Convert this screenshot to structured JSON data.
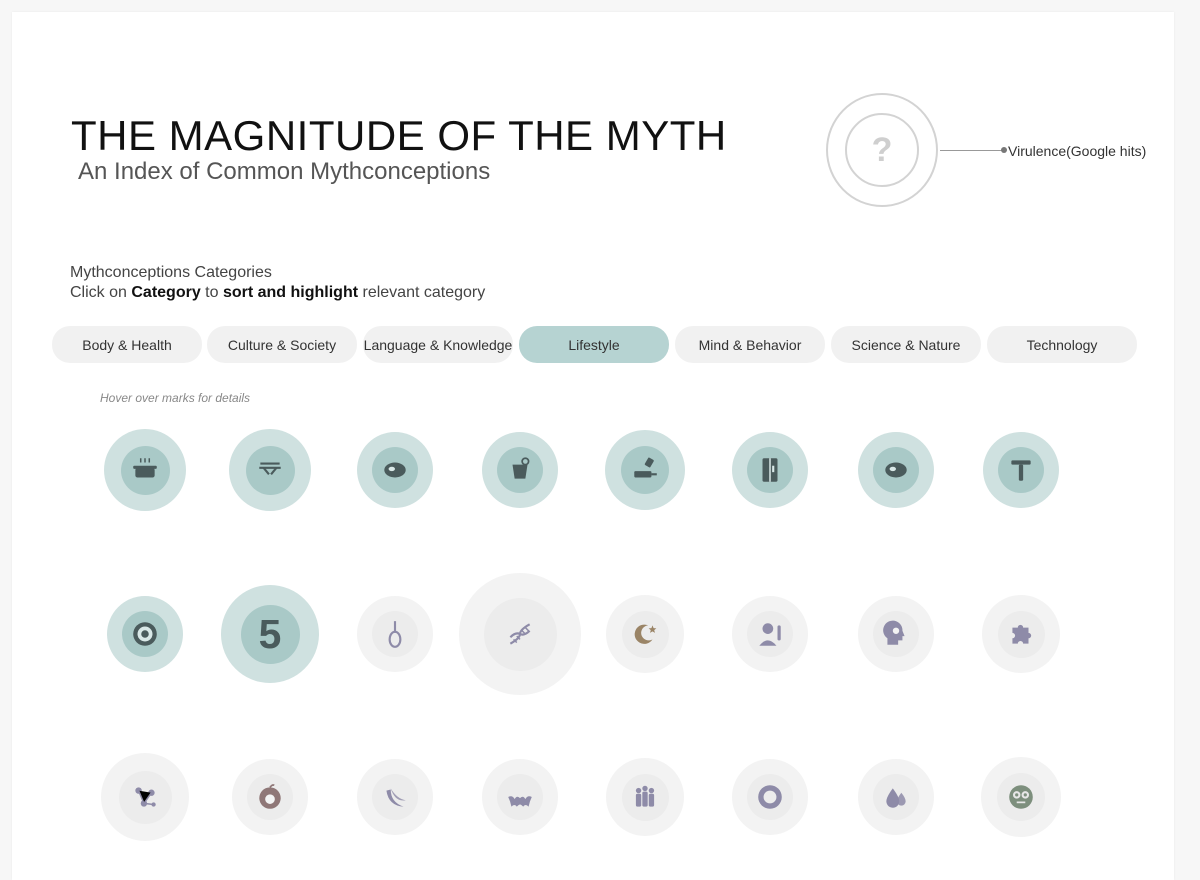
{
  "header": {
    "title": "THE MAGNITUDE OF THE MYTH",
    "subtitle": "An Index of Common Mythconceptions"
  },
  "legend": {
    "symbol": "?",
    "label": "Virulence(Google hits)"
  },
  "instructions": {
    "line1": "Mythconceptions Categories",
    "line2_parts": [
      "Click on ",
      "Category",
      " to ",
      "sort and highlight",
      " relevant category"
    ]
  },
  "tabs": [
    {
      "label": "Body & Health",
      "active": false
    },
    {
      "label": "Culture & Society",
      "active": false
    },
    {
      "label": "Language & Knowledge",
      "active": false
    },
    {
      "label": "Lifestyle",
      "active": true
    },
    {
      "label": "Mind & Behavior",
      "active": false
    },
    {
      "label": "Science & Nature",
      "active": false
    },
    {
      "label": "Technology",
      "active": false
    }
  ],
  "hint": "Hover over marks for details",
  "marks": [
    {
      "icon": "pot-icon",
      "highlighted": true
    },
    {
      "icon": "chopsticks-icon",
      "highlighted": true
    },
    {
      "icon": "steak-icon",
      "highlighted": true
    },
    {
      "icon": "cup-icon",
      "highlighted": true
    },
    {
      "icon": "salt-pan-icon",
      "highlighted": true
    },
    {
      "icon": "fridge-icon",
      "highlighted": true
    },
    {
      "icon": "steak-icon",
      "highlighted": true
    },
    {
      "icon": "razor-icon",
      "highlighted": true
    },
    {
      "icon": "sushi-icon",
      "highlighted": true
    },
    {
      "icon": "number-5-icon",
      "label": "5",
      "highlighted": true
    },
    {
      "icon": "noose-icon",
      "highlighted": false
    },
    {
      "icon": "dna-icon",
      "highlighted": false
    },
    {
      "icon": "crescent-star-icon",
      "highlighted": false
    },
    {
      "icon": "fever-person-icon",
      "highlighted": false
    },
    {
      "icon": "brain-head-icon",
      "highlighted": false
    },
    {
      "icon": "puzzle-icon",
      "highlighted": false
    },
    {
      "icon": "molecule-icon",
      "highlighted": false
    },
    {
      "icon": "apple-icon",
      "highlighted": false
    },
    {
      "icon": "banana-icon",
      "highlighted": false
    },
    {
      "icon": "bat-icon",
      "highlighted": false
    },
    {
      "icon": "crowd-icon",
      "highlighted": false
    },
    {
      "icon": "vortex-icon",
      "highlighted": false
    },
    {
      "icon": "drops-icon",
      "highlighted": false
    },
    {
      "icon": "goggle-face-icon",
      "highlighted": false
    }
  ],
  "colors": {
    "highlight_ring": "#cfe1e0",
    "highlight_core": "#a9c9c7",
    "highlight_icon": "#4a5b5c",
    "muted_ring": "#f3f3f3",
    "muted_core": "#ececec",
    "muted_icon": "#8e8ba8",
    "active_tab": "#b6d3d2",
    "tab": "#f1f1f1"
  }
}
